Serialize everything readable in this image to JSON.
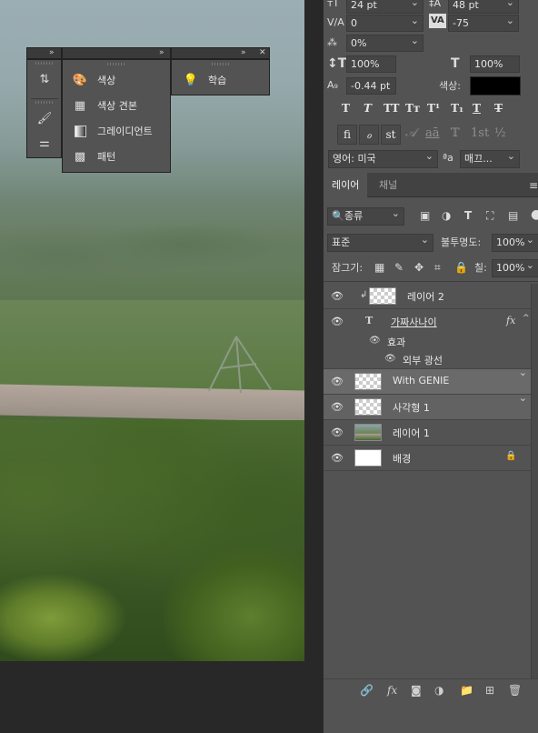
{
  "character_panel": {
    "font_size": "24 pt",
    "leading": "48 pt",
    "kerning": "0",
    "tracking": "-75",
    "scale_pct": "0%",
    "vertical_scale": "100%",
    "horizontal_scale": "100%",
    "baseline_shift": "-0.44 pt",
    "color_label": "색상:",
    "color_value": "#000000",
    "typo_buttons": [
      "T",
      "T",
      "TT",
      "Tт",
      "T¹",
      "T₁",
      "T",
      "T"
    ],
    "ot_buttons": [
      "fi",
      "ℴ",
      "st",
      "𝒜",
      "aā",
      "𝕋",
      "1st",
      "½"
    ],
    "language": "영어: 미국",
    "aa_label": "ªa",
    "antialias": "매끄..."
  },
  "float_panel": {
    "group1": [
      "색상",
      "색상 견본",
      "그레이디언트",
      "패턴"
    ],
    "group2": [
      "학습"
    ]
  },
  "layers_panel": {
    "tab_active": "레이어",
    "tab_inactive": "채널",
    "filter": "종류",
    "blend_mode": "표준",
    "opacity_label": "불투명도:",
    "opacity_value": "100%",
    "lock_label": "잠그기:",
    "fill_label": "칠:",
    "fill_value": "100%",
    "layers": [
      {
        "name": "레이어 2",
        "kind": "clip"
      },
      {
        "name": "가짜사나이",
        "kind": "text",
        "fx": "fx"
      },
      {
        "name": "효과",
        "kind": "effect"
      },
      {
        "name": "외부 광선",
        "kind": "effect-item"
      },
      {
        "name": "With GENIE",
        "kind": "image"
      },
      {
        "name": "사각형 1",
        "kind": "shape"
      },
      {
        "name": "레이어 1",
        "kind": "photo"
      },
      {
        "name": "배경",
        "kind": "background"
      }
    ]
  }
}
